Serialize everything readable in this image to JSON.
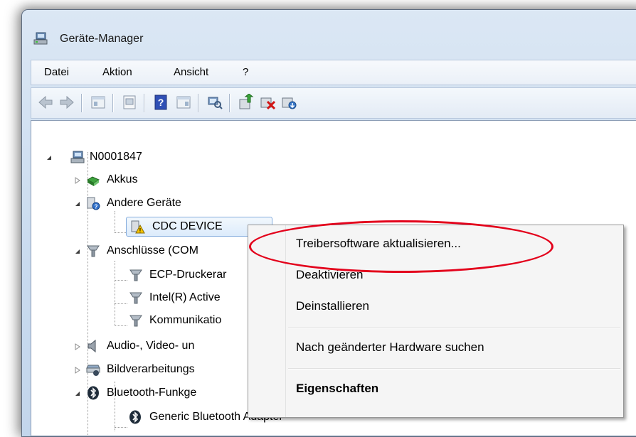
{
  "window": {
    "title": "Geräte-Manager"
  },
  "menu": {
    "items": [
      "Datei",
      "Aktion",
      "Ansicht",
      "?"
    ]
  },
  "toolbar": {
    "icons": [
      "back-arrow-icon",
      "forward-arrow-icon",
      "console-tree-icon",
      "properties-icon",
      "help-icon",
      "action-pane-icon",
      "scan-hardware-icon",
      "update-driver-icon",
      "disable-device-icon",
      "uninstall-device-icon"
    ]
  },
  "tree": {
    "root": "N0001847",
    "nodes": [
      {
        "label": "Akkus"
      },
      {
        "label": "Andere Geräte"
      },
      {
        "label": "CDC DEVICE"
      },
      {
        "label": "Anschlüsse (COM"
      },
      {
        "label": "ECP-Druckerar"
      },
      {
        "label": "Intel(R) Active"
      },
      {
        "label": "Kommunikatio"
      },
      {
        "label": "Audio-, Video- un"
      },
      {
        "label": "Bildverarbeitungs"
      },
      {
        "label": "Bluetooth-Funkge"
      },
      {
        "label": "Generic Bluetooth Adapter"
      }
    ]
  },
  "context_menu": {
    "items": [
      "Treibersoftware aktualisieren...",
      "Deaktivieren",
      "Deinstallieren",
      "Nach geänderter Hardware suchen",
      "Eigenschaften"
    ]
  },
  "colors": {
    "highlight": "#e3001b",
    "selection_border": "#84acdd"
  }
}
